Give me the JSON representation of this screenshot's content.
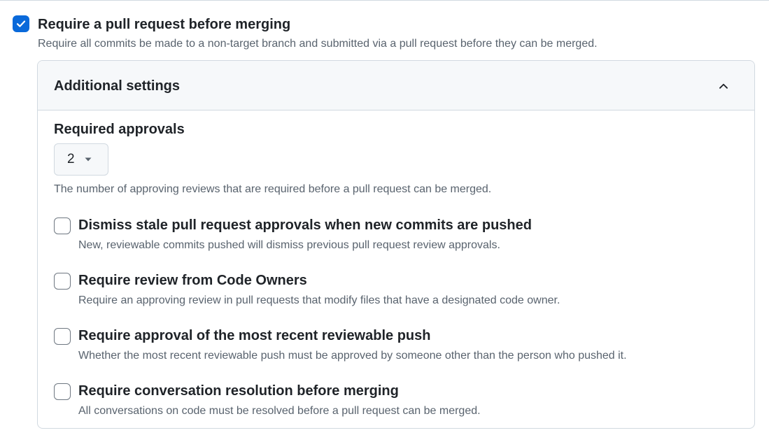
{
  "main_setting": {
    "checked": true,
    "title": "Require a pull request before merging",
    "description": "Require all commits be made to a non-target branch and submitted via a pull request before they can be merged."
  },
  "additional_settings": {
    "header": "Additional settings",
    "expanded": true,
    "required_approvals": {
      "label": "Required approvals",
      "value": "2",
      "help": "The number of approving reviews that are required before a pull request can be merged."
    },
    "options": [
      {
        "label": "Dismiss stale pull request approvals when new commits are pushed",
        "description": "New, reviewable commits pushed will dismiss previous pull request review approvals.",
        "checked": false
      },
      {
        "label": "Require review from Code Owners",
        "description": "Require an approving review in pull requests that modify files that have a designated code owner.",
        "checked": false
      },
      {
        "label": "Require approval of the most recent reviewable push",
        "description": "Whether the most recent reviewable push must be approved by someone other than the person who pushed it.",
        "checked": false
      },
      {
        "label": "Require conversation resolution before merging",
        "description": "All conversations on code must be resolved before a pull request can be merged.",
        "checked": false
      }
    ]
  },
  "colors": {
    "accent": "#0969da",
    "border": "#d1d9e0",
    "muted_text": "#59636e",
    "header_bg": "#f6f8fa"
  },
  "icons": {
    "main_checkbox": "checkmark-icon",
    "collapse": "chevron-up-icon",
    "select_caret": "triangle-down-icon"
  }
}
